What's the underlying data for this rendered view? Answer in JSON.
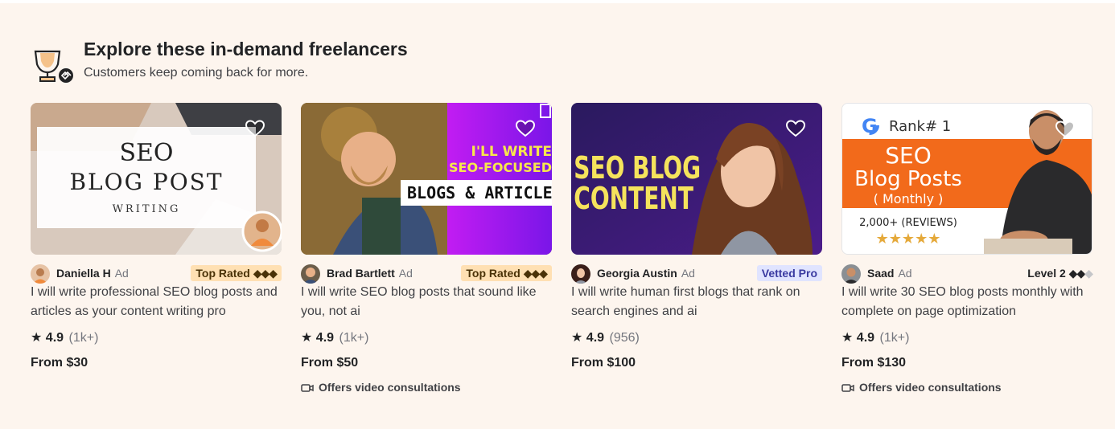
{
  "section": {
    "title": "Explore these in-demand freelancers",
    "subtitle": "Customers keep coming back for more."
  },
  "cards": [
    {
      "image_text": {
        "line1": "SEO",
        "line2": "BLOG POST",
        "line3": "WRITING"
      },
      "seller": "Daniella H",
      "ad": "Ad",
      "badge": "Top Rated",
      "badge_diamonds": "◆◆◆",
      "title": "I will write professional SEO blog posts and articles as your content writing pro",
      "rating": "4.9",
      "reviews": "(1k+)",
      "price": "From $30",
      "video": ""
    },
    {
      "image_text": {
        "line1": "I'LL WRITE",
        "line2": "SEO-FOCUSED",
        "line3": "BLOGS & ARTICLES"
      },
      "seller": "Brad Bartlett",
      "ad": "Ad",
      "badge": "Top Rated",
      "badge_diamonds": "◆◆◆",
      "title": "I will write SEO blog posts that sound like you, not ai",
      "rating": "4.9",
      "reviews": "(1k+)",
      "price": "From $50",
      "video": "Offers video consultations"
    },
    {
      "image_text": {
        "line1": "SEO BLOG",
        "line2": "CONTENT"
      },
      "seller": "Georgia Austin",
      "ad": "Ad",
      "badge": "Vetted Pro",
      "badge_diamonds": "",
      "title": "I will write human first blogs that rank on search engines and ai",
      "rating": "4.9",
      "reviews": "(956)",
      "price": "From $100",
      "video": ""
    },
    {
      "image_text": {
        "rank": "Rank# 1",
        "line1": "SEO",
        "line2": "Blog Posts",
        "line3": "( Monthly )",
        "reviews": "2,000+ (REVIEWS)",
        "stars": "★★★★★"
      },
      "seller": "Saad",
      "ad": "Ad",
      "badge": "Level 2",
      "badge_diamonds": "◆◆",
      "badge_diamonds_off": "◆",
      "title": "I will write 30 SEO blog posts monthly with complete on page optimization",
      "rating": "4.9",
      "reviews": "(1k+)",
      "price": "From $130",
      "video": "Offers video consultations"
    }
  ],
  "icons": {
    "header": "trophy-icon",
    "heart": "heart-icon",
    "star": "star-icon",
    "video": "video-camera-icon"
  },
  "colors": {
    "panel_bg": "#fdf5ee",
    "top_rated_badge": "#ffe0b3",
    "vetted_badge": "#e0e4ff",
    "accent_orange": "#f26a1b",
    "accent_purple": "#9b1cf0"
  }
}
